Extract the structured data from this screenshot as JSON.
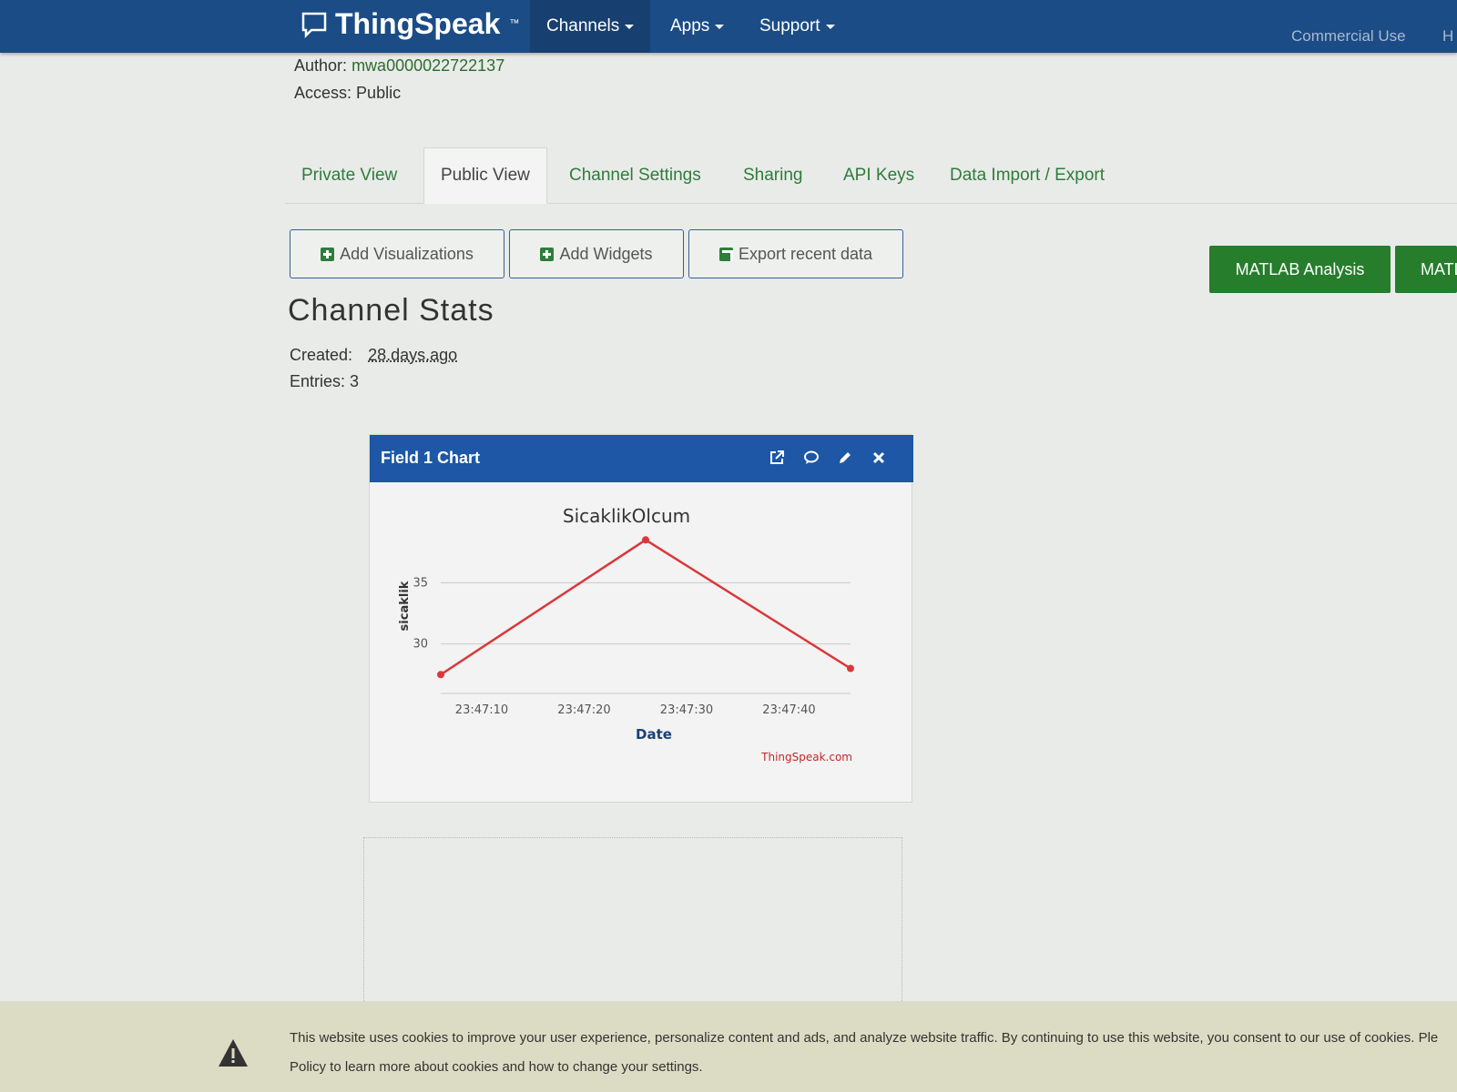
{
  "navbar": {
    "brand": "ThingSpeak",
    "trademark": "™",
    "channels": "Channels",
    "apps": "Apps",
    "support": "Support",
    "commercial_use": "Commercial Use",
    "truncated_right": "H"
  },
  "channel_meta": {
    "author_label": "Author:",
    "author_value": "mwa0000022722137",
    "access_label": "Access:",
    "access_value": "Public"
  },
  "tabs": [
    {
      "label": "Private View"
    },
    {
      "label": "Public View"
    },
    {
      "label": "Channel Settings"
    },
    {
      "label": "Sharing"
    },
    {
      "label": "API Keys"
    },
    {
      "label": "Data Import / Export"
    }
  ],
  "actions": {
    "add_visualizations": "Add Visualizations",
    "add_widgets": "Add Widgets",
    "export_recent": "Export recent data",
    "matlab_analysis": "MATLAB Analysis",
    "matlab_truncated": "MATL"
  },
  "stats": {
    "title": "Channel Stats",
    "created_label": "Created:",
    "created_value": "28.days.ago",
    "entries_label": "Entries:",
    "entries_value": "3"
  },
  "widget": {
    "title": "Field 1 Chart",
    "icons": [
      "external-link-icon",
      "comment-icon",
      "pencil-icon",
      "close-icon"
    ]
  },
  "chart_data": {
    "type": "line",
    "title": "SicaklikOlcum",
    "xlabel": "Date",
    "ylabel": "sicaklik",
    "credit": "ThingSpeak.com",
    "x_ticks": [
      "23:47:10",
      "23:47:20",
      "23:47:30",
      "23:47:40"
    ],
    "y_ticks": [
      30,
      35
    ],
    "ylim": [
      27,
      38
    ],
    "series": [
      {
        "color": "#d9383a",
        "x": [
          "23:47:06",
          "23:47:26",
          "23:47:46"
        ],
        "y": [
          27.5,
          38.5,
          28.0
        ]
      }
    ]
  },
  "cookie": {
    "line1": "This website uses cookies to improve your user experience, personalize content and ads, and analyze website traffic. By continuing to use this website, you consent to our use of cookies. Ple",
    "line2": "Policy to learn more about cookies and how to change your settings."
  }
}
